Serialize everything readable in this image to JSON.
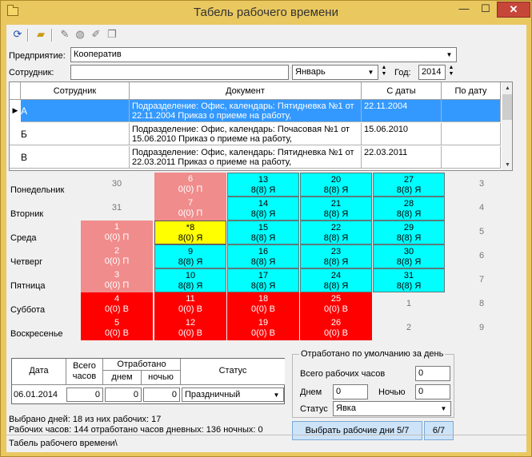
{
  "window": {
    "title": "Табель рабочего времени",
    "min_glyph": "—",
    "max_glyph": "☐",
    "close_glyph": "✕"
  },
  "toolbar": {
    "icons": [
      "refresh-icon",
      "open-folder-icon",
      "eraser-icon",
      "clear-icon",
      "edit-icon",
      "copy-icon"
    ]
  },
  "filters": {
    "enterprise_label": "Предприятие:",
    "enterprise_value": "Кооператив",
    "employee_label": "Сотрудник:",
    "employee_value": "",
    "month_value": "Январь",
    "year_label": "Год:",
    "year_value": "2014"
  },
  "grid": {
    "columns": [
      "Сотрудник",
      "Документ",
      "С даты",
      "По дату"
    ],
    "rows": [
      {
        "code": "А",
        "document": "Подразделение: Офис, календарь: Пятидневка №1 от 22.11.2004 Приказ о приеме на работу,",
        "from": "22.11.2004",
        "to": "",
        "selected": true
      },
      {
        "code": "Б",
        "document": "Подразделение: Офис, календарь: Почасовая №1 от 15.06.2010 Приказ о приеме на работу,",
        "from": "15.06.2010",
        "to": "",
        "selected": false
      },
      {
        "code": "В",
        "document": "Подразделение: Офис, календарь: Пятидневка №1 от 22.03.2011 Приказ о приеме на работу,",
        "from": "22.03.2011",
        "to": "",
        "selected": false
      }
    ]
  },
  "calendar": {
    "weekdays": [
      "Понедельник",
      "Вторник",
      "Среда",
      "Четверг",
      "Пятница",
      "Суббота",
      "Воскресенье"
    ],
    "cells": [
      {
        "col": 0,
        "row": 0,
        "day": "30",
        "info": "",
        "type": "outside"
      },
      {
        "col": 0,
        "row": 1,
        "day": "31",
        "info": "",
        "type": "outside"
      },
      {
        "col": 0,
        "row": 2,
        "day": "1",
        "info": "0(0) П",
        "type": "holiday"
      },
      {
        "col": 0,
        "row": 3,
        "day": "2",
        "info": "0(0) П",
        "type": "holiday"
      },
      {
        "col": 0,
        "row": 4,
        "day": "3",
        "info": "0(0) П",
        "type": "holiday"
      },
      {
        "col": 0,
        "row": 5,
        "day": "4",
        "info": "0(0) В",
        "type": "weekend"
      },
      {
        "col": 0,
        "row": 6,
        "day": "5",
        "info": "0(0) В",
        "type": "weekend"
      },
      {
        "col": 1,
        "row": 0,
        "day": "6",
        "info": "0(0) П",
        "type": "holiday"
      },
      {
        "col": 1,
        "row": 1,
        "day": "7",
        "info": "0(0) П",
        "type": "holiday"
      },
      {
        "col": 1,
        "row": 2,
        "day": "*8",
        "info": "8(0) Я",
        "type": "today"
      },
      {
        "col": 1,
        "row": 3,
        "day": "9",
        "info": "8(8) Я",
        "type": "work"
      },
      {
        "col": 1,
        "row": 4,
        "day": "10",
        "info": "8(8) Я",
        "type": "work"
      },
      {
        "col": 1,
        "row": 5,
        "day": "11",
        "info": "0(0) В",
        "type": "weekend"
      },
      {
        "col": 1,
        "row": 6,
        "day": "12",
        "info": "0(0) В",
        "type": "weekend"
      },
      {
        "col": 2,
        "row": 0,
        "day": "13",
        "info": "8(8) Я",
        "type": "work"
      },
      {
        "col": 2,
        "row": 1,
        "day": "14",
        "info": "8(8) Я",
        "type": "work"
      },
      {
        "col": 2,
        "row": 2,
        "day": "15",
        "info": "8(8) Я",
        "type": "work"
      },
      {
        "col": 2,
        "row": 3,
        "day": "16",
        "info": "8(8) Я",
        "type": "work"
      },
      {
        "col": 2,
        "row": 4,
        "day": "17",
        "info": "8(8) Я",
        "type": "work"
      },
      {
        "col": 2,
        "row": 5,
        "day": "18",
        "info": "0(0) В",
        "type": "weekend"
      },
      {
        "col": 2,
        "row": 6,
        "day": "19",
        "info": "0(0) В",
        "type": "weekend"
      },
      {
        "col": 3,
        "row": 0,
        "day": "20",
        "info": "8(8) Я",
        "type": "work"
      },
      {
        "col": 3,
        "row": 1,
        "day": "21",
        "info": "8(8) Я",
        "type": "work"
      },
      {
        "col": 3,
        "row": 2,
        "day": "22",
        "info": "8(8) Я",
        "type": "work"
      },
      {
        "col": 3,
        "row": 3,
        "day": "23",
        "info": "8(8) Я",
        "type": "work"
      },
      {
        "col": 3,
        "row": 4,
        "day": "24",
        "info": "8(8) Я",
        "type": "work"
      },
      {
        "col": 3,
        "row": 5,
        "day": "25",
        "info": "0(0) В",
        "type": "weekend"
      },
      {
        "col": 3,
        "row": 6,
        "day": "26",
        "info": "0(0) В",
        "type": "weekend"
      },
      {
        "col": 4,
        "row": 0,
        "day": "27",
        "info": "8(8) Я",
        "type": "work"
      },
      {
        "col": 4,
        "row": 1,
        "day": "28",
        "info": "8(8) Я",
        "type": "work"
      },
      {
        "col": 4,
        "row": 2,
        "day": "29",
        "info": "8(8) Я",
        "type": "work"
      },
      {
        "col": 4,
        "row": 3,
        "day": "30",
        "info": "8(8) Я",
        "type": "work"
      },
      {
        "col": 4,
        "row": 4,
        "day": "31",
        "info": "8(8) Я",
        "type": "work"
      },
      {
        "col": 4,
        "row": 5,
        "day": "1",
        "info": "",
        "type": "outside"
      },
      {
        "col": 4,
        "row": 6,
        "day": "2",
        "info": "",
        "type": "outside"
      },
      {
        "col": 5,
        "row": 0,
        "day": "3",
        "info": "",
        "type": "outside"
      },
      {
        "col": 5,
        "row": 1,
        "day": "4",
        "info": "",
        "type": "outside"
      },
      {
        "col": 5,
        "row": 2,
        "day": "5",
        "info": "",
        "type": "outside"
      },
      {
        "col": 5,
        "row": 3,
        "day": "6",
        "info": "",
        "type": "outside"
      },
      {
        "col": 5,
        "row": 4,
        "day": "7",
        "info": "",
        "type": "outside"
      },
      {
        "col": 5,
        "row": 5,
        "day": "8",
        "info": "",
        "type": "outside"
      },
      {
        "col": 5,
        "row": 6,
        "day": "9",
        "info": "",
        "type": "outside"
      }
    ]
  },
  "summary": {
    "col_date": "Дата",
    "col_total_hours": "Всего часов",
    "col_worked": "Отработано",
    "col_day": "днем",
    "col_night": "ночью",
    "col_status": "Статус",
    "date_value": "06.01.2014",
    "total_value": "0",
    "day_value": "0",
    "night_value": "0",
    "status_value": "Праздничный"
  },
  "defaults": {
    "legend": "Отработано по умолчанию за день",
    "total_label": "Всего рабочих часов",
    "total_value": "0",
    "day_label": "Днем",
    "day_value": "0",
    "night_label": "Ночью",
    "night_value": "0",
    "status_label": "Статус",
    "status_value": "Явка"
  },
  "actions": {
    "select_workdays": "Выбрать рабочие дни 5/7",
    "mode": "6/7"
  },
  "info": {
    "line1": "Выбрано дней: 18 из них рабочих: 17",
    "line2": "Рабочих часов: 144 отработано часов дневных: 136 ночных: 0"
  },
  "status_bar": "Табель рабочего времени\\"
}
